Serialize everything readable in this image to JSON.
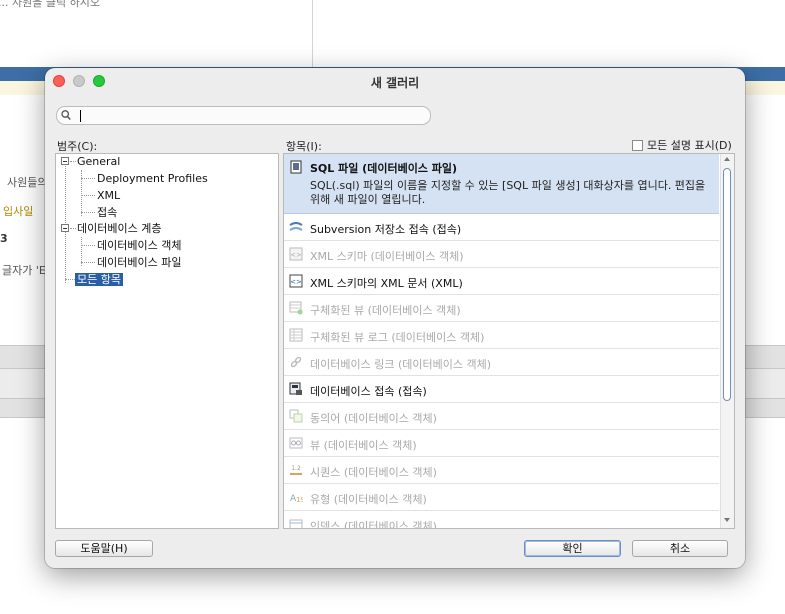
{
  "background": {
    "hint_text": "... 사원을 클릭 하시오",
    "side_texts": [
      "사원들의",
      "입사일",
      "3",
      "글자가 'E"
    ],
    "side_text_colors": [
      "#555555",
      "#b08a00",
      "#333333",
      "#555555"
    ]
  },
  "dialog": {
    "title": "새 갤러리",
    "search": {
      "value": "",
      "placeholder": ""
    },
    "category_label": "범주(C):",
    "items_label": "항목(I):",
    "show_all_label": "모든 설명 표시(D)",
    "categories": [
      {
        "label": "General",
        "level": 0,
        "expanded": true,
        "selected": false
      },
      {
        "label": "Deployment Profiles",
        "level": 1,
        "selected": false
      },
      {
        "label": "XML",
        "level": 1,
        "selected": false
      },
      {
        "label": "접속",
        "level": 1,
        "selected": false
      },
      {
        "label": "데이터베이스 계층",
        "level": 0,
        "expanded": true,
        "selected": false
      },
      {
        "label": "데이터베이스 객체",
        "level": 1,
        "selected": false
      },
      {
        "label": "데이터베이스 파일",
        "level": 1,
        "selected": false
      },
      {
        "label": "모든 항목",
        "level": 0,
        "selected": true
      }
    ],
    "items": [
      {
        "label": "SQL 파일 (데이터베이스 파일)",
        "icon": "sql-file-icon",
        "state": "selected",
        "description": "SQL(.sql) 파일의 이름을 지정할 수 있는 [SQL 파일 생성] 대화상자를 엽니다. 편집을 위해 새 파일이 열립니다."
      },
      {
        "label": "Subversion 저장소 접속 (접속)",
        "icon": "subversion-icon",
        "state": "enabled"
      },
      {
        "label": "XML 스키마 (데이터베이스 객체)",
        "icon": "xml-schema-icon",
        "state": "disabled"
      },
      {
        "label": "XML 스키마의 XML 문서 (XML)",
        "icon": "xml-document-icon",
        "state": "enabled"
      },
      {
        "label": "구체화된 뷰 (데이터베이스 객체)",
        "icon": "materialized-view-icon",
        "state": "disabled"
      },
      {
        "label": "구체화된 뷰 로그 (데이터베이스 객체)",
        "icon": "materialized-view-log-icon",
        "state": "disabled"
      },
      {
        "label": "데이터베이스 링크 (데이터베이스 객체)",
        "icon": "database-link-icon",
        "state": "disabled"
      },
      {
        "label": "데이터베이스 접속 (접속)",
        "icon": "database-connection-icon",
        "state": "enabled"
      },
      {
        "label": "동의어 (데이터베이스 객체)",
        "icon": "synonym-icon",
        "state": "disabled"
      },
      {
        "label": "뷰 (데이터베이스 객체)",
        "icon": "view-icon",
        "state": "disabled"
      },
      {
        "label": "시퀀스 (데이터베이스 객체)",
        "icon": "sequence-icon",
        "state": "disabled"
      },
      {
        "label": "유형 (데이터베이스 객체)",
        "icon": "type-icon",
        "state": "disabled"
      },
      {
        "label": "인덱스 (데이터베이스 객체)",
        "icon": "index-icon",
        "state": "disabled"
      }
    ],
    "buttons": {
      "help": "도움말(H)",
      "ok": "확인",
      "cancel": "취소"
    },
    "colors": {
      "accent": "#2a5fa8",
      "selected_row": "#d5e2f3",
      "disabled_text": "#a9a9a9"
    }
  }
}
